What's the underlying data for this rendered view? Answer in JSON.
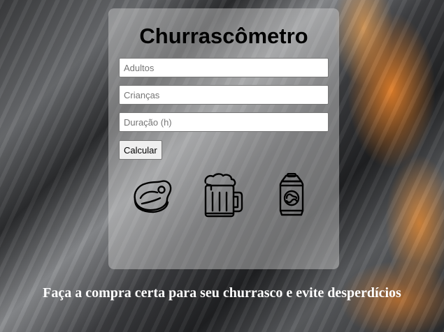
{
  "app": {
    "title": "Churrascômetro"
  },
  "form": {
    "adults_placeholder": "Adultos",
    "adults_value": "",
    "children_placeholder": "Crianças",
    "children_value": "",
    "duration_placeholder": "Duração (h)",
    "duration_value": "",
    "submit_label": "Calcular"
  },
  "icons": [
    {
      "name": "meat-steak-icon"
    },
    {
      "name": "beer-mug-icon"
    },
    {
      "name": "soda-can-icon"
    }
  ],
  "footer": {
    "tagline": "Faça a compra certa para seu churrasco e evite desperdícios"
  },
  "colors": {
    "panel_background": "#d2d2d2",
    "text_primary": "#000000",
    "tagline_text": "#ffffff",
    "accent_fire": "#ff8c28"
  }
}
